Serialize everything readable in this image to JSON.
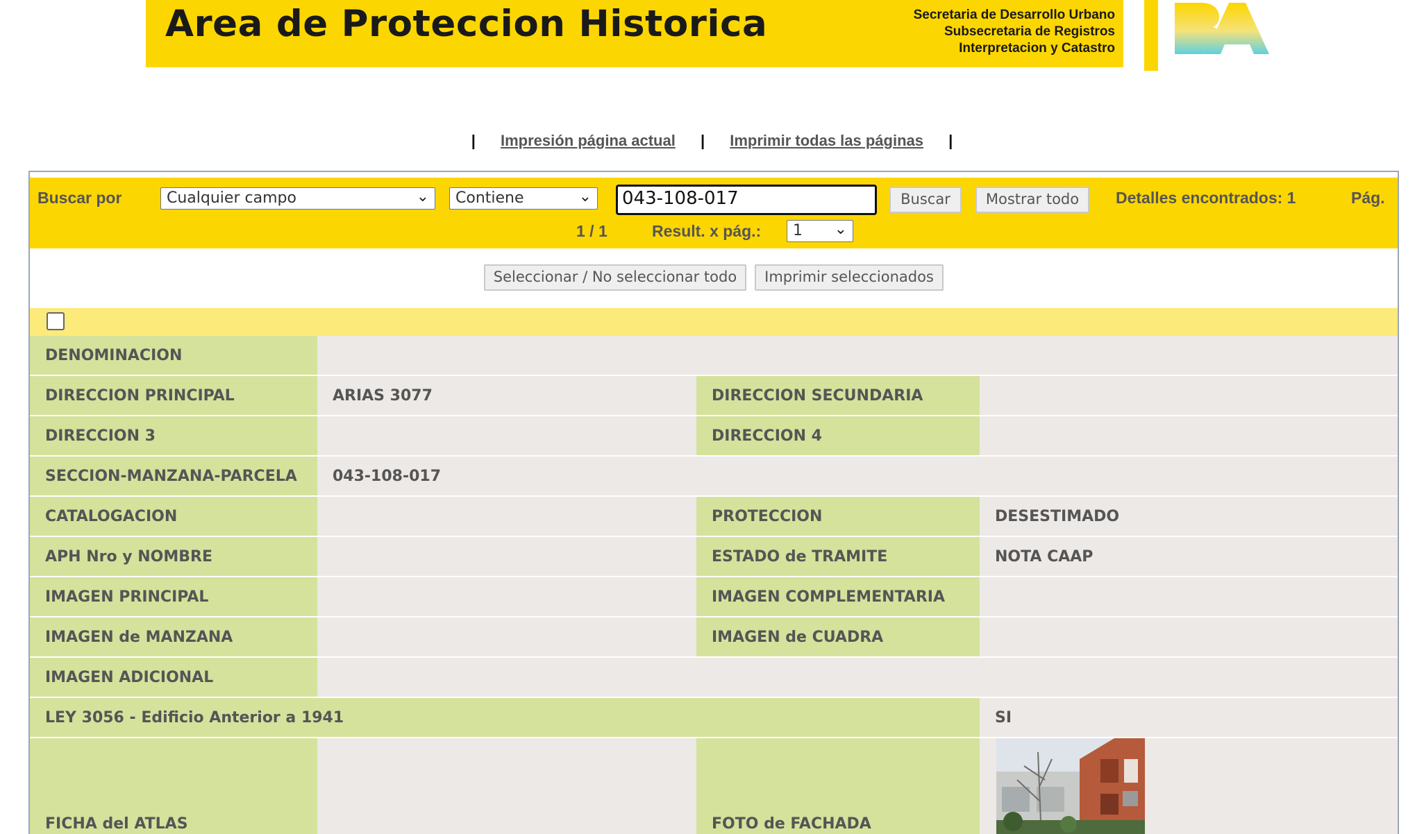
{
  "header": {
    "title": "Area de Proteccion Historica",
    "subtitle_lines": [
      "Secretaria de Desarrollo Urbano",
      "Subsecretaria de Registros",
      "Interpretacion y Catastro"
    ],
    "logo_text": "BA",
    "brand_color": "#fcd600"
  },
  "print_links": {
    "separator": "|",
    "current_page": "Impresión página actual",
    "all_pages": "Imprimir todas las páginas"
  },
  "search": {
    "label": "Buscar por",
    "field_select": "Cualquier campo",
    "operator_select": "Contiene",
    "query_value": "043-108-017",
    "search_button": "Buscar",
    "show_all_button": "Mostrar todo",
    "found_label": "Detalles encontrados: 1",
    "page_label": "Pág.",
    "pagination": "1 / 1",
    "per_page_label": "Result. x pág.:",
    "per_page_value": "1"
  },
  "actions": {
    "select_all_button": "Seleccionar / No seleccionar todo",
    "print_selected_button": "Imprimir seleccionados"
  },
  "detail": {
    "denominacion_label": "DENOMINACION",
    "denominacion_value": "",
    "direccion_principal_label": "DIRECCION PRINCIPAL",
    "direccion_principal_value": "ARIAS 3077",
    "direccion_secundaria_label": "DIRECCION SECUNDARIA",
    "direccion_secundaria_value": "",
    "direccion_3_label": "DIRECCION 3",
    "direccion_3_value": "",
    "direccion_4_label": "DIRECCION 4",
    "direccion_4_value": "",
    "smp_label": "SECCION-MANZANA-PARCELA",
    "smp_value": "043-108-017",
    "catalogacion_label": "CATALOGACION",
    "catalogacion_value": "",
    "proteccion_label": "PROTECCION",
    "proteccion_value": "DESESTIMADO",
    "aph_label": "APH Nro y NOMBRE",
    "aph_value": "",
    "estado_label": "ESTADO de TRAMITE",
    "estado_value": "NOTA CAAP",
    "imagen_principal_label": "IMAGEN PRINCIPAL",
    "imagen_complementaria_label": "IMAGEN COMPLEMENTARIA",
    "imagen_manzana_label": "IMAGEN de MANZANA",
    "imagen_cuadra_label": "IMAGEN de CUADRA",
    "imagen_adicional_label": "IMAGEN ADICIONAL",
    "ley_label": "LEY 3056 - Edificio Anterior a 1941",
    "ley_value": "SI",
    "ficha_label": "FICHA del ATLAS",
    "foto_label": "FOTO de FACHADA"
  },
  "colors": {
    "label_bg": "#d4e29c",
    "value_bg": "#ede9e6",
    "row_highlight": "#fcea7a"
  }
}
